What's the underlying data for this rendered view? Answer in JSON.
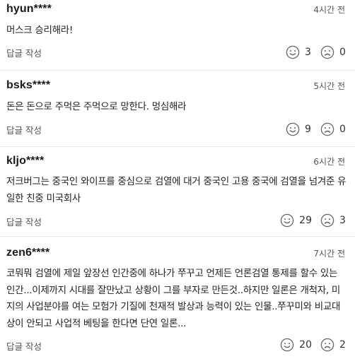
{
  "comments": [
    {
      "author": "hyun****",
      "time": "4시간 전",
      "lines": [
        "머스크 승리해라!"
      ],
      "reply_label": "답글 작성",
      "likes": "3",
      "dislikes": "0"
    },
    {
      "author": "bsks****",
      "time": "5시간 전",
      "lines": [
        "돈은 돈으로 주먹은 주먹으로 망한다. 멍심해라"
      ],
      "reply_label": "답글 작성",
      "likes": "9",
      "dislikes": "0"
    },
    {
      "author": "kljo****",
      "time": "6시간 전",
      "lines": [
        "저크버그는 중국인 와이프를 중심으로 검열에 대거 중국인 고용 중국에 검열을 넘겨준 유",
        "일한 친중 미국회사"
      ],
      "reply_label": "답글 작성",
      "likes": "29",
      "dislikes": "3"
    },
    {
      "author": "zen6****",
      "time": "7시간 전",
      "lines": [
        "코뭐뭐 검열에 제일 앞장선 인간중에 하나가 쭈꾸고 언제든 언론검열 통제를 할수 있는",
        "인간...이제까지 시대를 잘만났고 상황이 그를 부자로 만든것..하지만 일론은 개척자, 미",
        "지의 사업분야를 여는 모험가 기질에 천재적 발상과 능력이 있는 인물..쭈꾸미와 비교대",
        "상이 안되고 사업적 베팅을 한다면 단연 일론..."
      ],
      "reply_label": "답글 작성",
      "likes": "20",
      "dislikes": "2"
    }
  ],
  "icons": {
    "like": "smile-face-icon",
    "dislike": "frown-face-icon"
  }
}
